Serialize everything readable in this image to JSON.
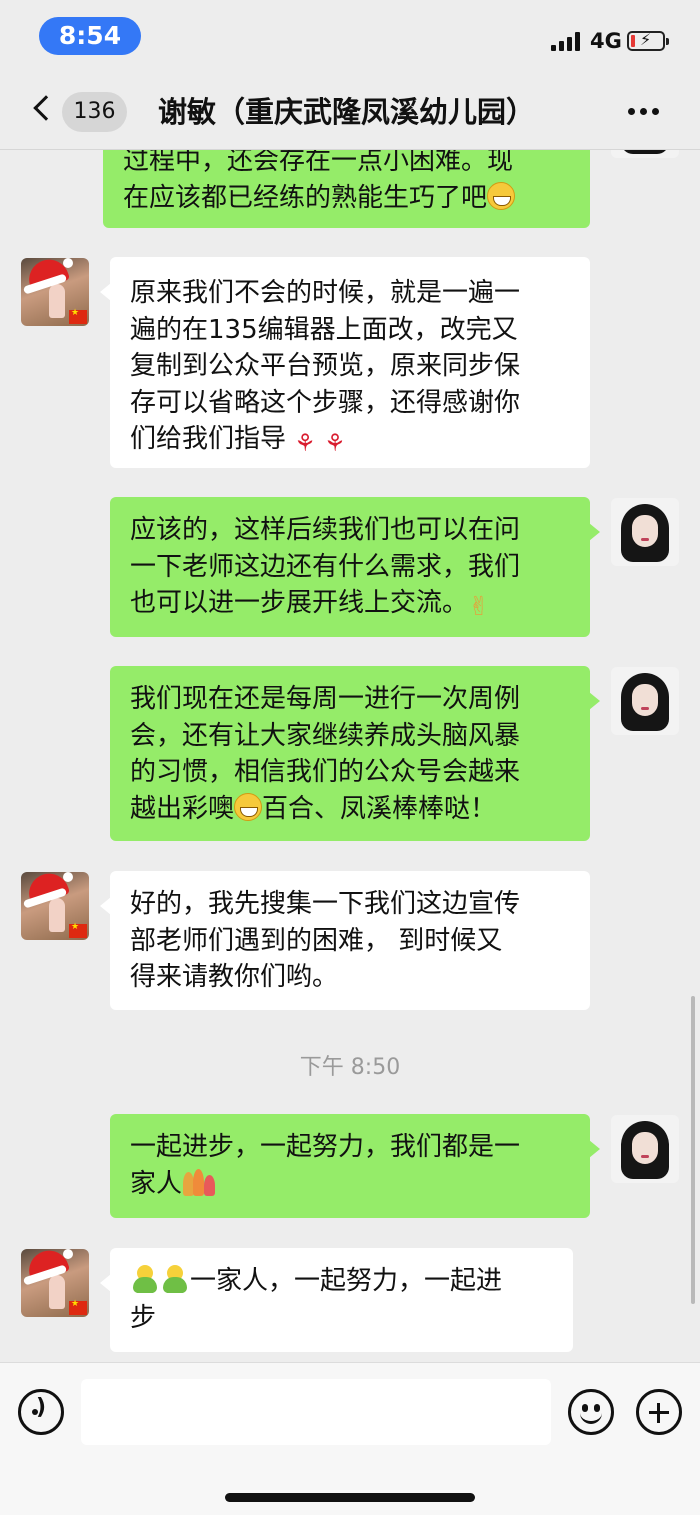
{
  "status_bar": {
    "time": "8:54",
    "network": "4G",
    "battery_level": 0.08,
    "battery_color": "#e53935",
    "time_pill_color": "#3478f6"
  },
  "header": {
    "back_icon": "chevron-left-icon",
    "unread_count": "136",
    "title": "谢敏（重庆武隆凤溪幼儿园）",
    "more_icon": "more-dots-icon"
  },
  "colors": {
    "background": "#ededed",
    "outgoing_bubble": "#95ec69",
    "incoming_bubble": "#ffffff"
  },
  "messages": [
    {
      "direction": "outgoing",
      "lines": [
        "过程中，还会存在一点小困难。现",
        "在应该都已经练的熟能生巧了吧"
      ],
      "trailing_emoji": "grin-emoji"
    },
    {
      "direction": "incoming",
      "lines": [
        "原来我们不会的时候，就是一遍一",
        "遍的在135编辑器上面改，改完又",
        "复制到公众平台预览，原来同步保",
        "存可以省略这个步骤，还得感谢你",
        "们给我们指导"
      ],
      "trailing_emoji": "rose-emoji"
    },
    {
      "direction": "outgoing",
      "lines": [
        "应该的，这样后续我们也可以在问",
        "一下老师这边还有什么需求，我们",
        "也可以进一步展开线上交流。"
      ],
      "trailing_emoji": "ok-hand-emoji"
    },
    {
      "direction": "outgoing",
      "lines": [
        "我们现在还是每周一进行一次周例",
        "会，还有让大家继续养成头脑风暴",
        "的习惯，相信我们的公众号会越来",
        "越出彩噢",
        "百合、凤溪棒棒哒！"
      ],
      "inline_emoji": "grin-emoji"
    },
    {
      "direction": "incoming",
      "lines": [
        "好的，我先搜集一下我们这边宣传",
        "部老师们遇到的困难， 到时候又",
        "得来请教你们哟。"
      ]
    },
    {
      "direction": "outgoing",
      "lines": [
        "一起进步，一起努力，我们都是一",
        "家人"
      ],
      "trailing_emoji": "family-emoji"
    },
    {
      "direction": "incoming",
      "lines": [
        "一家人，一起努力，一起进",
        "步"
      ],
      "leading_emoji": "blob-emoji"
    }
  ],
  "timestamp": "下午 8:50",
  "input_bar": {
    "voice_icon": "voice-icon",
    "input_value": "",
    "emoji_icon": "emoji-face-icon",
    "plus_icon": "plus-icon"
  }
}
